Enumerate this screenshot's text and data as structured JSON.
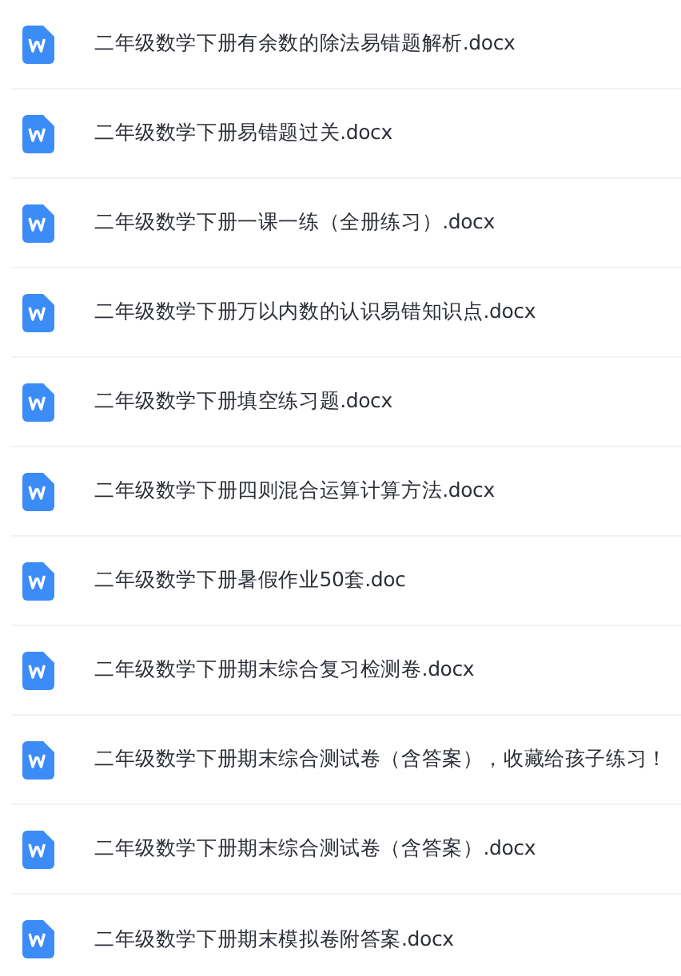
{
  "files": [
    {
      "name": "二年级数学下册有余数的除法易错题解析.docx",
      "kind": "word"
    },
    {
      "name": "二年级数学下册易错题过关.docx",
      "kind": "word"
    },
    {
      "name": "二年级数学下册一课一练（全册练习）.docx",
      "kind": "word"
    },
    {
      "name": "二年级数学下册万以内数的认识易错知识点.docx",
      "kind": "word"
    },
    {
      "name": "二年级数学下册填空练习题.docx",
      "kind": "word"
    },
    {
      "name": "二年级数学下册四则混合运算计算方法.docx",
      "kind": "word"
    },
    {
      "name": "二年级数学下册暑假作业50套.doc",
      "kind": "word"
    },
    {
      "name": "二年级数学下册期末综合复习检测卷.docx",
      "kind": "word"
    },
    {
      "name": "二年级数学下册期末综合测试卷（含答案），收藏给孩子练习！",
      "kind": "word"
    },
    {
      "name": "二年级数学下册期末综合测试卷（含答案）.docx",
      "kind": "word"
    },
    {
      "name": "二年级数学下册期末模拟卷附答案.docx",
      "kind": "word"
    }
  ]
}
